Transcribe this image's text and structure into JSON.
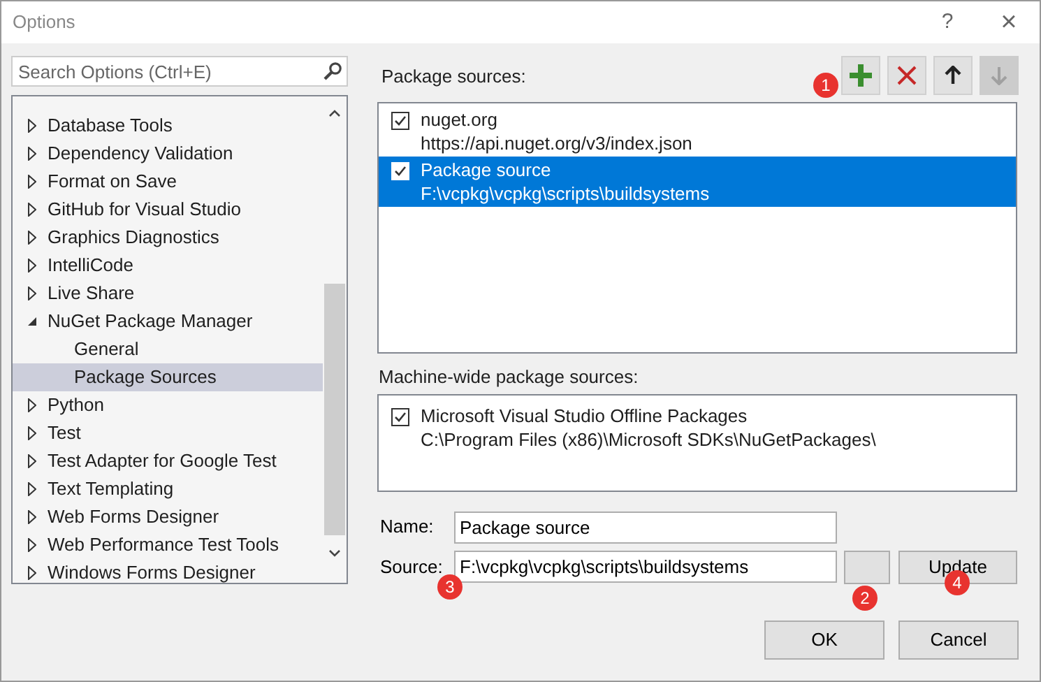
{
  "window": {
    "title": "Options",
    "help": "?",
    "close": "×"
  },
  "search": {
    "placeholder": "Search Options (Ctrl+E)"
  },
  "tree": [
    {
      "label": "Database Tools",
      "expanded": false,
      "selected": false
    },
    {
      "label": "Dependency Validation",
      "expanded": false,
      "selected": false
    },
    {
      "label": "Format on Save",
      "expanded": false,
      "selected": false
    },
    {
      "label": "GitHub for Visual Studio",
      "expanded": false,
      "selected": false
    },
    {
      "label": "Graphics Diagnostics",
      "expanded": false,
      "selected": false
    },
    {
      "label": "IntelliCode",
      "expanded": false,
      "selected": false
    },
    {
      "label": "Live Share",
      "expanded": false,
      "selected": false
    },
    {
      "label": "NuGet Package Manager",
      "expanded": true,
      "selected": false,
      "children": [
        {
          "label": "General",
          "selected": false
        },
        {
          "label": "Package Sources",
          "selected": true
        }
      ]
    },
    {
      "label": "Python",
      "expanded": false,
      "selected": false
    },
    {
      "label": "Test",
      "expanded": false,
      "selected": false
    },
    {
      "label": "Test Adapter for Google Test",
      "expanded": false,
      "selected": false
    },
    {
      "label": "Text Templating",
      "expanded": false,
      "selected": false
    },
    {
      "label": "Web Forms Designer",
      "expanded": false,
      "selected": false
    },
    {
      "label": "Web Performance Test Tools",
      "expanded": false,
      "selected": false
    },
    {
      "label": "Windows Forms Designer",
      "expanded": false,
      "selected": false
    }
  ],
  "package_sources": {
    "label": "Package sources:",
    "toolbar": [
      {
        "kind": "add",
        "disabled": false,
        "badge": "1"
      },
      {
        "kind": "remove",
        "disabled": false
      },
      {
        "kind": "up",
        "disabled": false
      },
      {
        "kind": "down",
        "disabled": true
      }
    ],
    "items": [
      {
        "name": "nuget.org",
        "url": "https://api.nuget.org/v3/index.json",
        "checked": true,
        "selected": false
      },
      {
        "name": "Package source",
        "url": "F:\\vcpkg\\vcpkg\\scripts\\buildsystems",
        "checked": true,
        "selected": true
      }
    ]
  },
  "machine_wide": {
    "label": "Machine-wide package sources:",
    "items": [
      {
        "name": "Microsoft Visual Studio Offline Packages",
        "url": "C:\\Program Files (x86)\\Microsoft SDKs\\NuGetPackages\\",
        "checked": true,
        "selected": false
      }
    ]
  },
  "name_field": {
    "label": "Name:",
    "value": "Package source"
  },
  "source_field": {
    "label": "Source:",
    "value": "F:\\vcpkg\\vcpkg\\scripts\\buildsystems",
    "badge": "3"
  },
  "browse_button": {
    "badge": "2"
  },
  "update_button": {
    "label": "Update",
    "badge": "4"
  },
  "buttons": [
    "OK",
    "Cancel"
  ]
}
